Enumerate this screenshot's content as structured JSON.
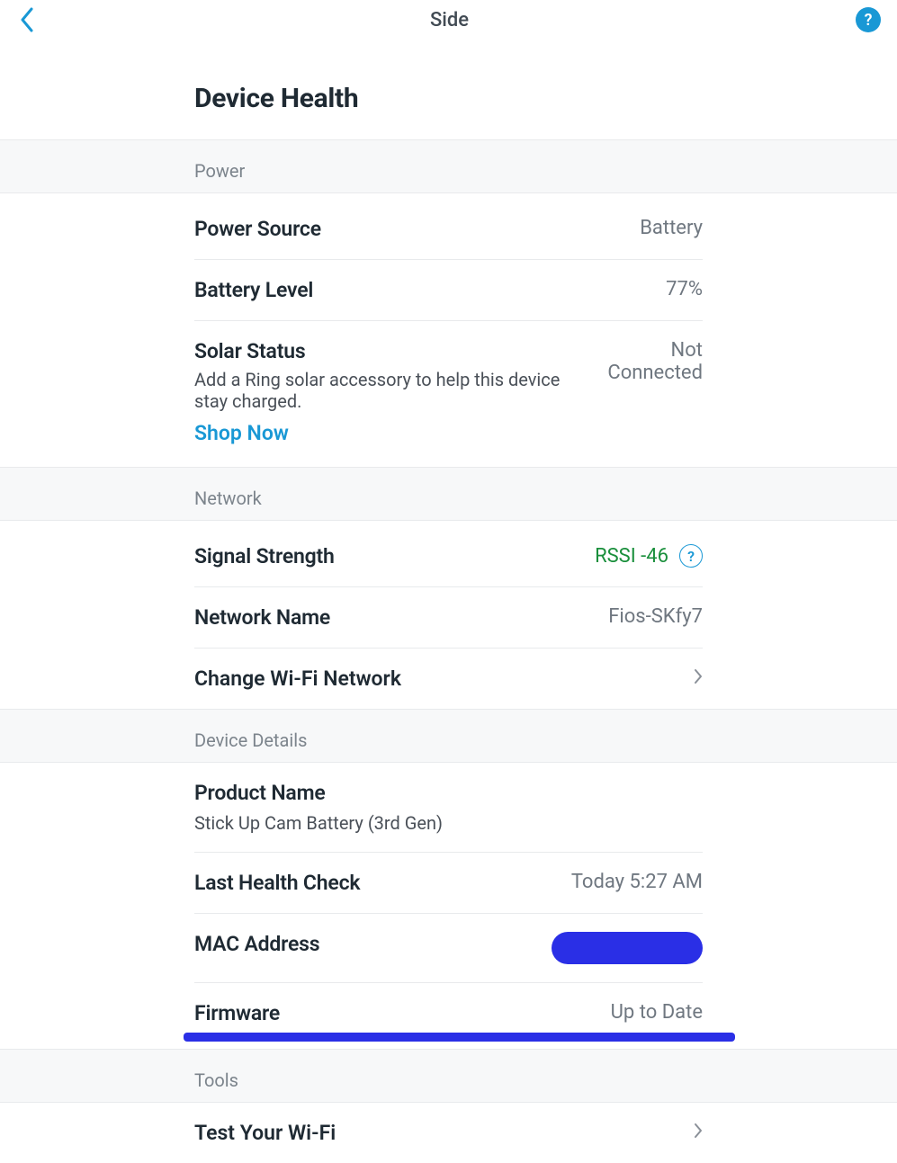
{
  "header": {
    "title": "Side"
  },
  "page": {
    "title": "Device Health"
  },
  "sections": {
    "power": {
      "header": "Power",
      "power_source": {
        "label": "Power Source",
        "value": "Battery"
      },
      "battery_level": {
        "label": "Battery Level",
        "value": "77%"
      },
      "solar_status": {
        "label": "Solar Status",
        "value": "Not Connected",
        "hint": "Add a Ring solar accessory to help this device stay charged."
      },
      "shop_now": "Shop Now"
    },
    "network": {
      "header": "Network",
      "signal_strength": {
        "label": "Signal Strength",
        "value": "RSSI -46"
      },
      "network_name": {
        "label": "Network Name",
        "value": "Fios-SKfy7"
      },
      "change_wifi": {
        "label": "Change Wi-Fi Network"
      }
    },
    "device_details": {
      "header": "Device Details",
      "product_name": {
        "label": "Product Name",
        "value": "Stick Up Cam Battery (3rd Gen)"
      },
      "last_health_check": {
        "label": "Last Health Check",
        "value": "Today 5:27 AM"
      },
      "mac_address": {
        "label": "MAC Address"
      },
      "firmware": {
        "label": "Firmware",
        "value": "Up to Date"
      }
    },
    "tools": {
      "header": "Tools",
      "test_wifi": {
        "label": "Test Your Wi-Fi"
      }
    }
  }
}
